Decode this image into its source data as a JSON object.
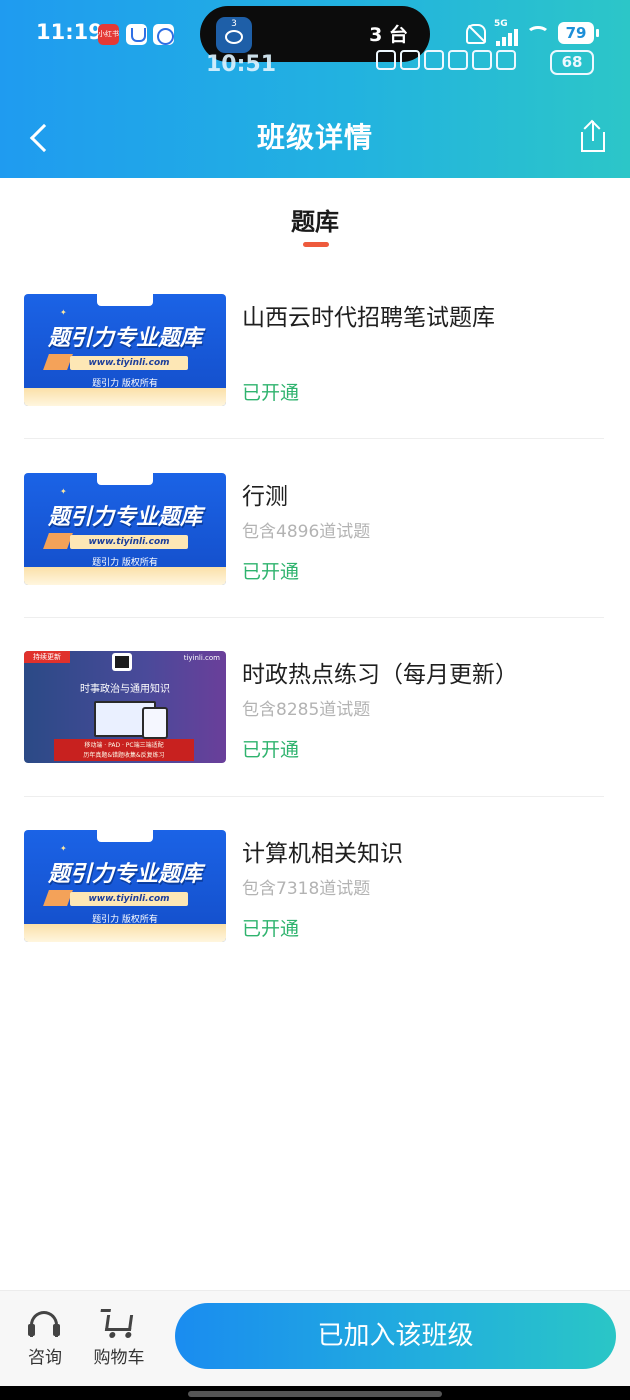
{
  "status_bar": {
    "time": "11:19",
    "app_badge": "小红书",
    "island_count": "3",
    "island_text": "3 台",
    "network": "5G",
    "battery": "79"
  },
  "overlay_status": {
    "time": "10:51",
    "battery": "68"
  },
  "nav": {
    "title": "班级详情"
  },
  "section": {
    "title": "题库"
  },
  "thumb_text": {
    "main": "题引力专业题库",
    "url": "www.tiyinli.com",
    "copyright": "题引力 版权所有",
    "dark_tag": "持续更新",
    "dark_url": "tiyinli.com",
    "dark_heading": "时事政治与通用知识",
    "dark_line1": "移动端 · PAD · PC端三端适配",
    "dark_line2": "历年真题&错题收集&反复练习"
  },
  "items": [
    {
      "title": "山西云时代招聘笔试题库",
      "count": "",
      "status": "已开通",
      "thumb": "blue"
    },
    {
      "title": "行测",
      "count": "包含4896道试题",
      "status": "已开通",
      "thumb": "blue"
    },
    {
      "title": "时政热点练习（每月更新）",
      "count": "包含8285道试题",
      "status": "已开通",
      "thumb": "dark"
    },
    {
      "title": "计算机相关知识",
      "count": "包含7318道试题",
      "status": "已开通",
      "thumb": "blue"
    }
  ],
  "bottom_bar": {
    "consult_label": "咨询",
    "cart_label": "购物车",
    "join_label": "已加入该班级"
  },
  "colors": {
    "header_gradient_start": "#1f9bf0",
    "header_gradient_end": "#2cc6c8",
    "status_open": "#2fb36e",
    "tab_indicator": "#ee5a3c"
  },
  "icons": [
    "back-arrow-icon",
    "share-icon",
    "headset-icon",
    "cart-icon"
  ]
}
